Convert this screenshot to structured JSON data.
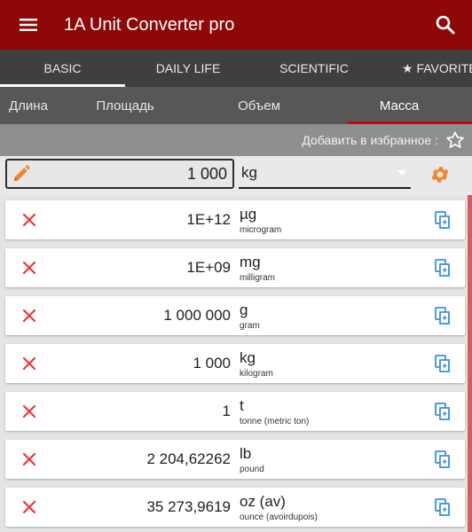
{
  "app": {
    "title": "1A Unit Converter pro",
    "accent_color": "#8e0808",
    "icons": {
      "menu": "hamburger-icon",
      "search": "search-icon"
    }
  },
  "tabs": [
    {
      "label": "BASIC",
      "active": true
    },
    {
      "label": "DAILY LIFE",
      "active": false
    },
    {
      "label": "SCIENTIFIC",
      "active": false
    },
    {
      "label": "★ FAVORITES",
      "active": false
    }
  ],
  "subtabs": [
    {
      "label": "Длина",
      "active": false
    },
    {
      "label": "Площадь",
      "active": false
    },
    {
      "label": "Объем",
      "active": false
    },
    {
      "label": "Масса",
      "active": true
    }
  ],
  "favorites": {
    "label": "Добавить в избранное :",
    "icon": "star-outline-icon"
  },
  "input": {
    "value": "1 000",
    "unit": "kg",
    "icons": {
      "edit": "pencil-icon",
      "dropdown": "dropdown-icon",
      "settings": "gear-icon"
    }
  },
  "results": [
    {
      "value": "1E+12",
      "symbol": "µg",
      "name": "microgram"
    },
    {
      "value": "1E+09",
      "symbol": "mg",
      "name": "milligram"
    },
    {
      "value": "1 000 000",
      "symbol": "g",
      "name": "gram"
    },
    {
      "value": "1 000",
      "symbol": "kg",
      "name": "kilogram"
    },
    {
      "value": "1",
      "symbol": "t",
      "name": "tonne (metric ton)"
    },
    {
      "value": "2 204,62262",
      "symbol": "lb",
      "name": "pound"
    },
    {
      "value": "35 273,9619",
      "symbol": "oz (av)",
      "name": "ounce (avoirdupois)"
    }
  ]
}
